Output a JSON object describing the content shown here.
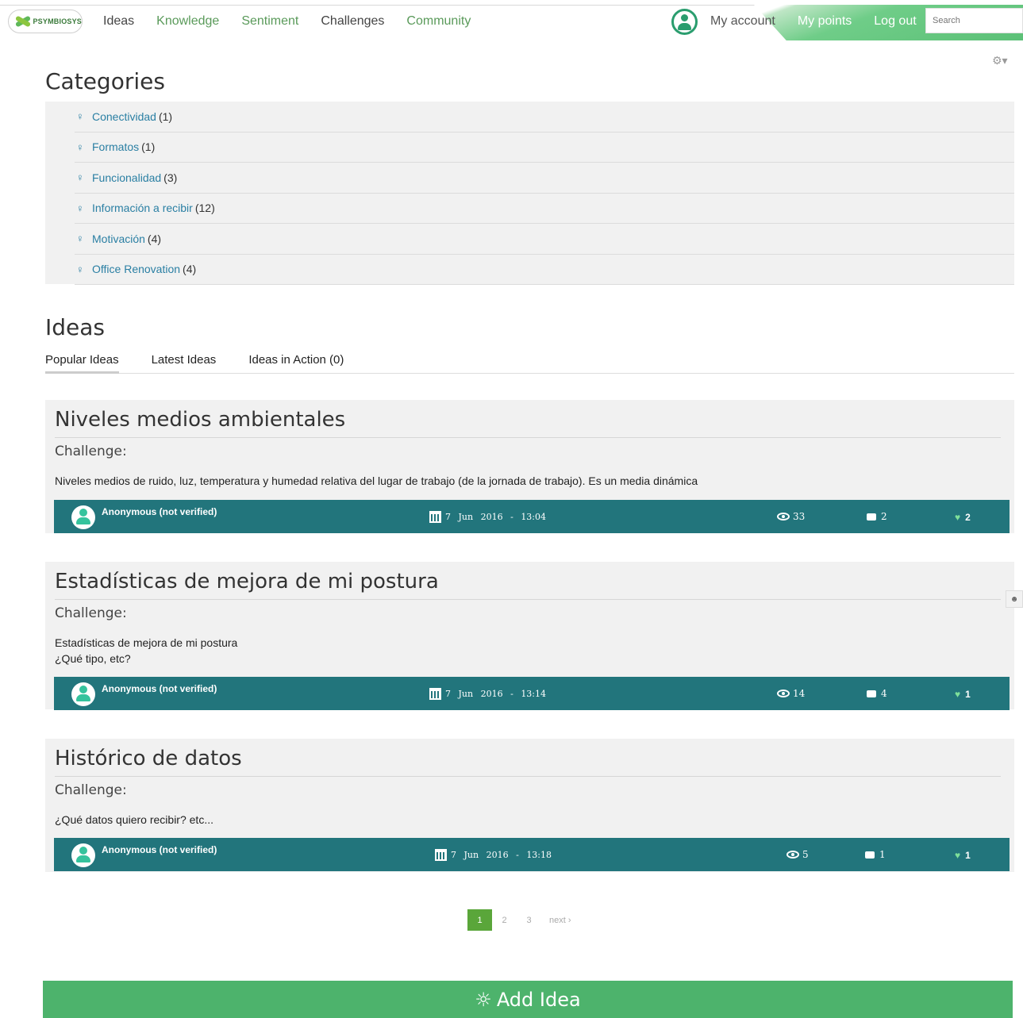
{
  "brand": {
    "logo_text": "PSYMBIOSYS"
  },
  "nav": {
    "items": [
      "Ideas",
      "Knowledge",
      "Sentiment",
      "Challenges",
      "Community"
    ]
  },
  "user_links": {
    "account": "My account",
    "points": "My points",
    "logout": "Log out"
  },
  "search": {
    "placeholder": "Search"
  },
  "categories": {
    "title": "Categories",
    "items": [
      {
        "name": "Conectividad",
        "count": "(1)"
      },
      {
        "name": "Formatos",
        "count": "(1)"
      },
      {
        "name": "Funcionalidad",
        "count": "(3)"
      },
      {
        "name": "Información a recibir",
        "count": "(12)"
      },
      {
        "name": "Motivación",
        "count": "(4)"
      },
      {
        "name": "Office Renovation",
        "count": "(4)"
      }
    ]
  },
  "ideas": {
    "title": "Ideas",
    "tabs": [
      "Popular Ideas",
      "Latest Ideas",
      "Ideas in Action (0)"
    ],
    "cards": [
      {
        "title": "Niveles medios ambientales",
        "challenge": "Challenge:",
        "body": "Niveles medios de ruido, luz, temperatura y humedad relativa del lugar de trabajo (de la jornada de trabajo). Es un media dinámica",
        "author": "Anonymous (not verified)",
        "day": "7",
        "month": "Jun",
        "year": "2016",
        "sep": "-",
        "time": "13:04",
        "views": "33",
        "comments": "2",
        "likes": "2"
      },
      {
        "title": "Estadísticas de mejora de mi postura",
        "challenge": "Challenge:",
        "body_line1": "Estadísticas de mejora de mi postura",
        "body_line2": "¿Qué tipo, etc?",
        "author": "Anonymous (not verified)",
        "day": "7",
        "month": "Jun",
        "year": "2016",
        "sep": "-",
        "time": "13:14",
        "views": "14",
        "comments": "4",
        "likes": "1"
      },
      {
        "title": "Histórico de datos",
        "challenge": "Challenge:",
        "body": "¿Qué datos quiero recibir? etc...",
        "author": "Anonymous (not verified)",
        "day": "7",
        "month": "Jun",
        "year": "2016",
        "sep": "-",
        "time": "13:18",
        "views": "5",
        "comments": "1",
        "likes": "1"
      }
    ]
  },
  "pager": {
    "pages": [
      "1",
      "2",
      "3"
    ],
    "next": "next ›"
  },
  "add_button": {
    "label": "Add Idea"
  },
  "colors": {
    "accent_green": "#4db36c",
    "teal_meta": "#22757c",
    "link_blue": "#2a7fa3"
  }
}
